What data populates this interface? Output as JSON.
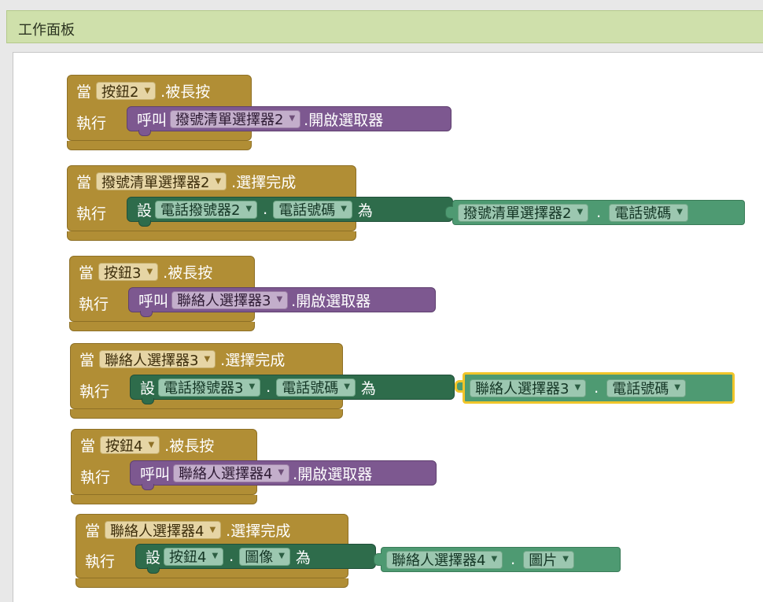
{
  "panel": {
    "title": "工作面板"
  },
  "blocks": [
    {
      "kw_when": "當",
      "component": "按鈕2",
      "event": ".被長按",
      "kw_do": "執行",
      "body": {
        "kind": "call",
        "kw": "呼叫",
        "component": "撥號清單選擇器2",
        "method": ".開啟選取器"
      }
    },
    {
      "kw_when": "當",
      "component": "撥號清單選擇器2",
      "event": ".選擇完成",
      "kw_do": "執行",
      "body": {
        "kind": "set",
        "kw_set": "設",
        "component": "電話撥號器2",
        "dot": ".",
        "property": "電話號碼",
        "kw_to": "為",
        "get_component": "撥號清單選擇器2",
        "get_dot": ".",
        "get_property": "電話號碼"
      }
    },
    {
      "kw_when": "當",
      "component": "按鈕3",
      "event": ".被長按",
      "kw_do": "執行",
      "body": {
        "kind": "call",
        "kw": "呼叫",
        "component": "聯絡人選擇器3",
        "method": ".開啟選取器"
      }
    },
    {
      "kw_when": "當",
      "component": "聯絡人選擇器3",
      "event": ".選擇完成",
      "kw_do": "執行",
      "body": {
        "kind": "set",
        "kw_set": "設",
        "component": "電話撥號器3",
        "dot": ".",
        "property": "電話號碼",
        "kw_to": "為",
        "get_component": "聯絡人選擇器3",
        "get_dot": ".",
        "get_property": "電話號碼"
      }
    },
    {
      "kw_when": "當",
      "component": "按鈕4",
      "event": ".被長按",
      "kw_do": "執行",
      "body": {
        "kind": "call",
        "kw": "呼叫",
        "component": "聯絡人選擇器4",
        "method": ".開啟選取器"
      }
    },
    {
      "kw_when": "當",
      "component": "聯絡人選擇器4",
      "event": ".選擇完成",
      "kw_do": "執行",
      "body": {
        "kind": "set",
        "kw_set": "設",
        "component": "按鈕4",
        "dot": ".",
        "property": "圖像",
        "kw_to": "為",
        "get_component": "聯絡人選擇器4",
        "get_dot": ".",
        "get_property": "圖片"
      }
    }
  ],
  "icons": {
    "dropdown": "▼"
  },
  "colors": {
    "event_block": "#b18e35",
    "call_block": "#7d5890",
    "setter_block": "#2e6c4b",
    "getter_block": "#4e9a72",
    "selected_outline": "#f0c52a",
    "header": "#cfe0ab"
  }
}
